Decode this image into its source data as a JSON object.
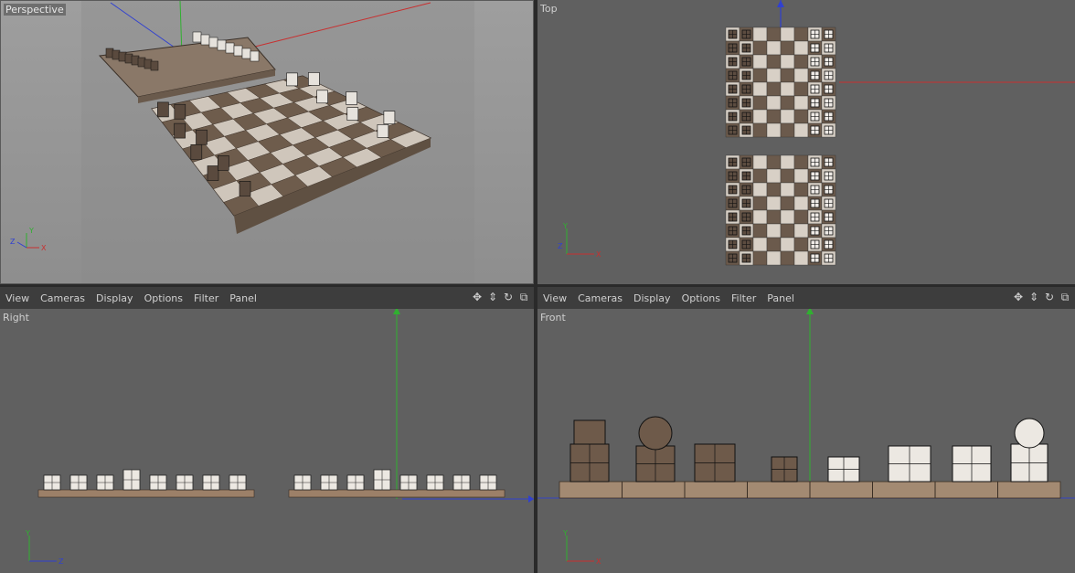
{
  "viewports": {
    "perspective": {
      "label": "Perspective"
    },
    "top": {
      "label": "Top"
    },
    "right": {
      "label": "Right"
    },
    "front": {
      "label": "Front"
    }
  },
  "menu_left": [
    "View",
    "Cameras",
    "Display",
    "Options",
    "Filter",
    "Panel"
  ],
  "menu_right": [
    "View",
    "Cameras",
    "Display",
    "Options",
    "Filter",
    "Panel"
  ],
  "nav_icons": [
    "move-icon",
    "dolly-icon",
    "rotate-icon",
    "maximize-icon"
  ],
  "axis_labels": {
    "x": "X",
    "y": "Y",
    "z": "Z"
  },
  "colors": {
    "axis_x": "#c83030",
    "axis_y": "#30b030",
    "axis_z": "#3040d0",
    "dark_square": "#6b5a4c",
    "light_square": "#d8d0c6"
  }
}
